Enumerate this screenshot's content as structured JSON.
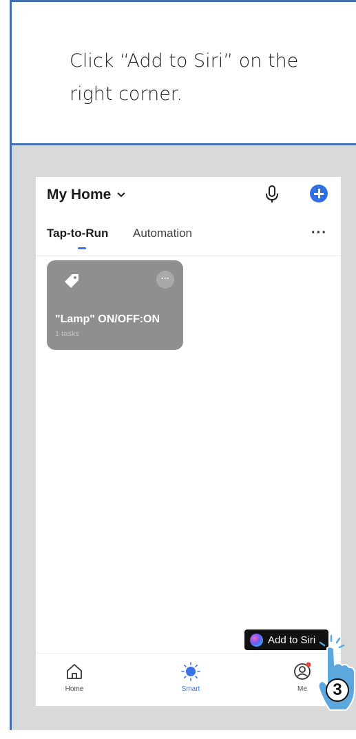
{
  "instruction": "Click “Add to Siri” on the right corner.",
  "app": {
    "home_title": "My Home",
    "tabs": [
      {
        "label": "Tap-to-Run",
        "active": true
      },
      {
        "label": "Automation",
        "active": false
      }
    ],
    "more_label": "···",
    "scene_card": {
      "title": "\"Lamp\" ON/OFF:ON",
      "subtitle": "1 tasks",
      "more_label": "···"
    },
    "siri_button_label": "Add to Siri",
    "tabbar": [
      {
        "label": "Home",
        "icon": "home-icon"
      },
      {
        "label": "Smart",
        "icon": "sun-icon",
        "active": true
      },
      {
        "label": "Me",
        "icon": "user-icon"
      }
    ]
  },
  "step_number": "3",
  "colors": {
    "accent": "#3b72e8",
    "frame_border": "#3f6fb2",
    "card_bg": "#8f8f8f",
    "panel_bg": "#d9d9d9",
    "hand": "#5ba7de"
  }
}
